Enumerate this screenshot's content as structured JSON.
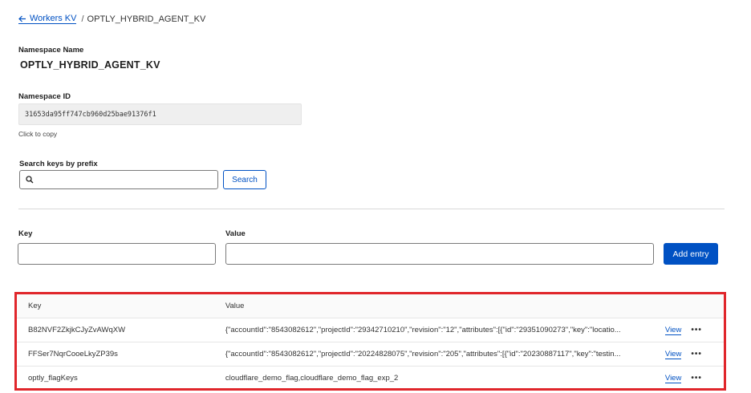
{
  "breadcrumb": {
    "back_label": "Workers KV",
    "separator": "/",
    "current": "OPTLY_HYBRID_AGENT_KV"
  },
  "namespace": {
    "name_label": "Namespace Name",
    "name_value": "OPTLY_HYBRID_AGENT_KV",
    "id_label": "Namespace ID",
    "id_value": "31653da95ff747cb960d25bae91376f1",
    "copy_hint": "Click to copy"
  },
  "search": {
    "label": "Search keys by prefix",
    "value": "",
    "placeholder": "",
    "button_label": "Search"
  },
  "add_form": {
    "key_label": "Key",
    "value_label": "Value",
    "key_value": "",
    "value_value": "",
    "button_label": "Add entry"
  },
  "table": {
    "columns": [
      "Key",
      "Value"
    ],
    "rows": [
      {
        "key": "B82NVF2ZkjkCJyZvAWqXW",
        "value": "{\"accountId\":\"8543082612\",\"projectId\":\"29342710210\",\"revision\":\"12\",\"attributes\":[{\"id\":\"29351090273\",\"key\":\"locatio...",
        "view_label": "View",
        "more_label": "•••"
      },
      {
        "key": "FFSer7NqrCooeLkyZP39s",
        "value": "{\"accountId\":\"8543082612\",\"projectId\":\"20224828075\",\"revision\":\"205\",\"attributes\":[{\"id\":\"20230887117\",\"key\":\"testin...",
        "view_label": "View",
        "more_label": "•••"
      },
      {
        "key": "optly_flagKeys",
        "value": "cloudflare_demo_flag,cloudflare_demo_flag_exp_2",
        "view_label": "View",
        "more_label": "•••"
      }
    ]
  },
  "colors": {
    "accent": "#0051c3",
    "highlight_border": "#e0262b"
  },
  "icons": {
    "back": "arrow-left-icon",
    "search": "search-icon",
    "more": "ellipsis-icon"
  }
}
